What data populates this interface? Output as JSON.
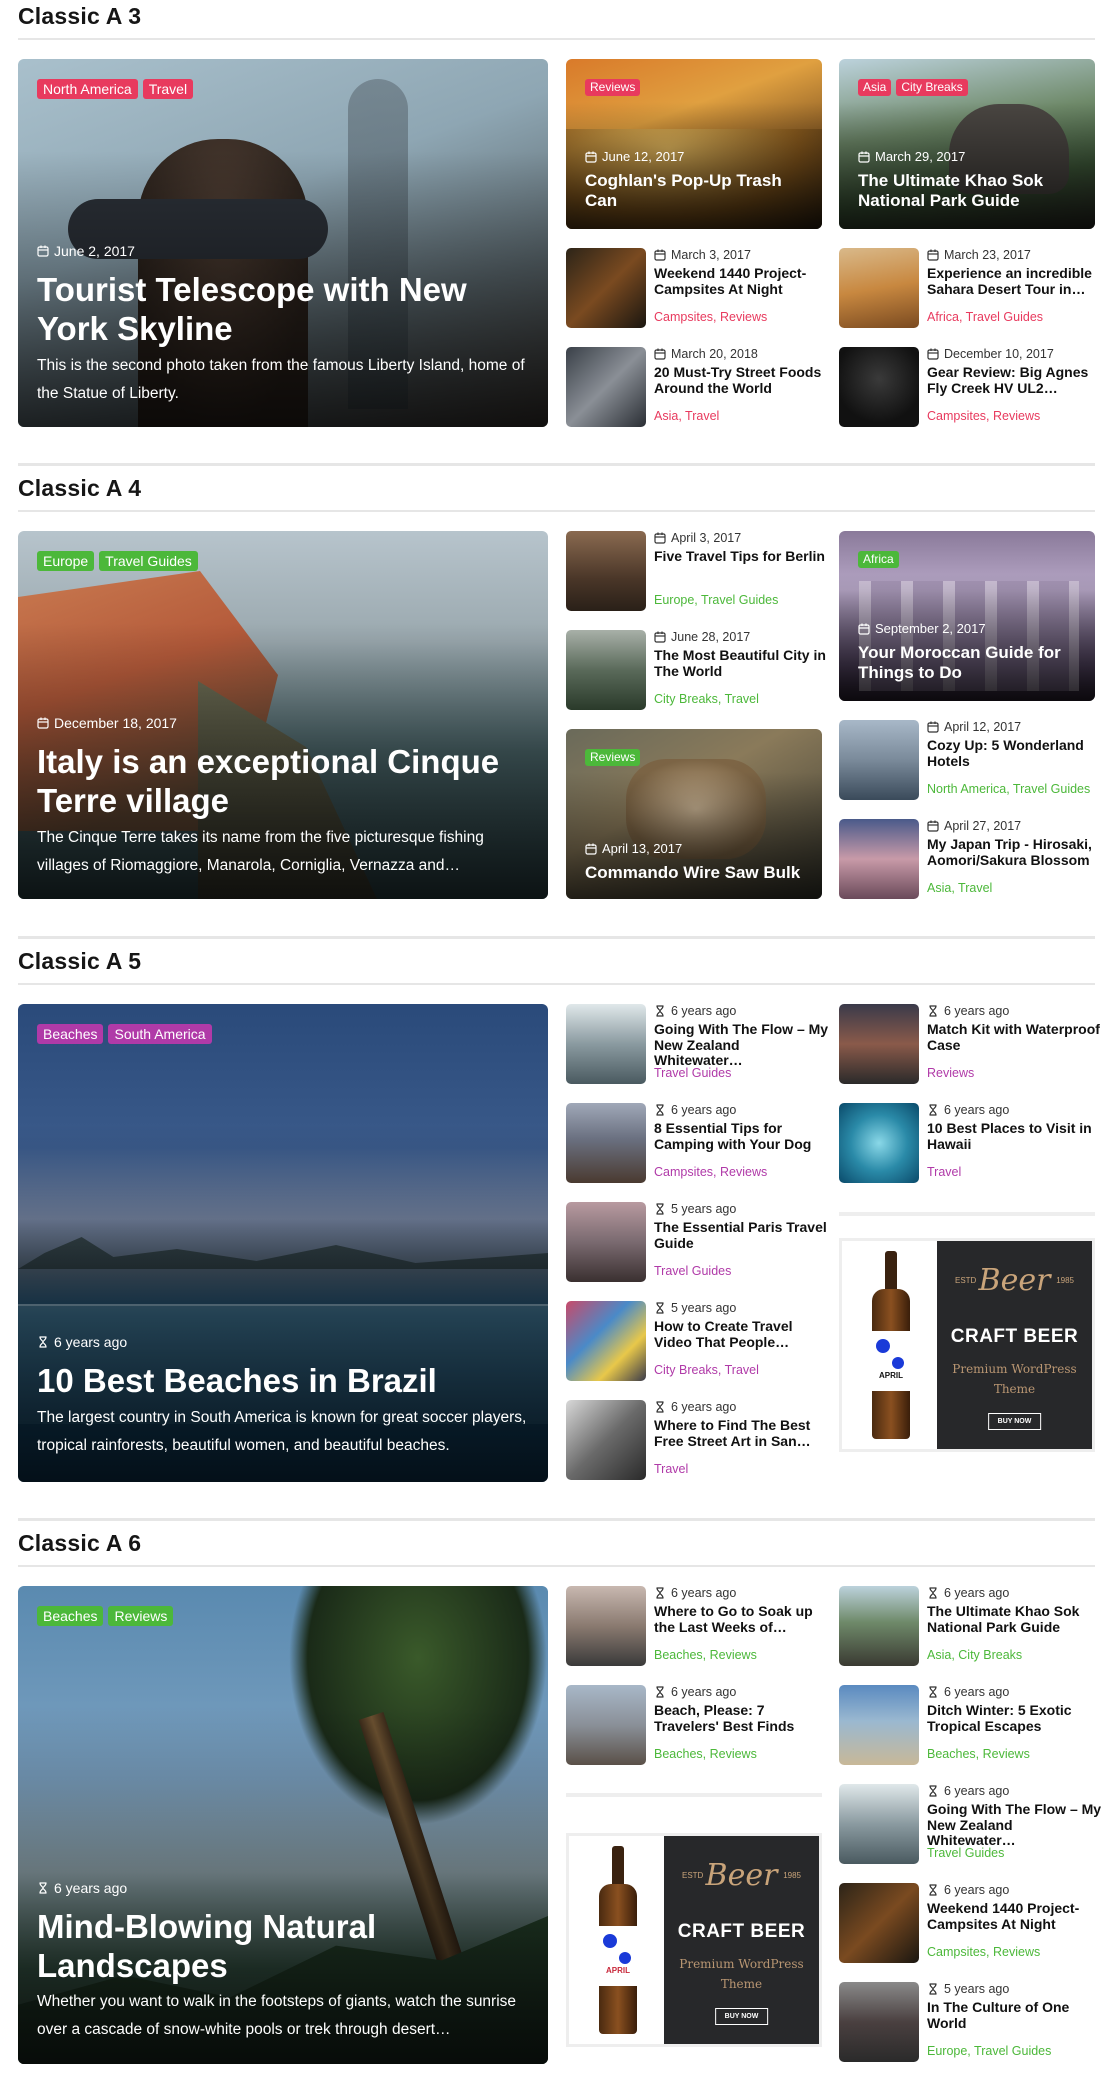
{
  "colors": {
    "red": "#e83a5e",
    "green": "#4cb83a",
    "purple": "#b03aa8"
  },
  "sections": [
    {
      "title": "Classic A 3",
      "featured": {
        "tags": [
          "North America",
          "Travel"
        ],
        "date": "June 2, 2017",
        "title": "Tourist Telescope with New York Skyline",
        "excerpt": "This is the second photo taken from the famous Liberty Island, home of the Statue of Liberty."
      },
      "mid_cards": [
        {
          "tags": [
            "Reviews"
          ],
          "date": "June 12, 2017",
          "title": "Coghlan's Pop-Up Trash Can"
        },
        {
          "tags": [
            "Asia",
            "City Breaks"
          ],
          "date": "March 29, 2017",
          "title": "The Ultimate Khao Sok National Park Guide"
        }
      ],
      "items": [
        {
          "date": "March 3, 2017",
          "title": "Weekend 1440 Project-Campsites At Night",
          "cats": "Campsites, Reviews"
        },
        {
          "date": "March 20, 2018",
          "title": "20 Must-Try Street Foods Around the World",
          "cats": "Asia, Travel"
        },
        {
          "date": "March 23, 2017",
          "title": "Experience an incredible Sahara Desert Tour in…",
          "cats": "Africa, Travel Guides"
        },
        {
          "date": "December 10, 2017",
          "title": "Gear Review: Big Agnes Fly Creek HV UL2…",
          "cats": "Campsites, Reviews"
        }
      ]
    },
    {
      "title": "Classic A 4",
      "featured": {
        "tags": [
          "Europe",
          "Travel Guides"
        ],
        "date": "December 18, 2017",
        "title": "Italy is an exceptional Cinque Terre village",
        "excerpt": "The Cinque Terre takes its name from the five picturesque fishing villages of Riomaggiore, Manarola, Corniglia, Vernazza and…"
      },
      "mid_cards": [
        {
          "tags": [
            "Reviews"
          ],
          "date": "April 13, 2017",
          "title": "Commando Wire Saw Bulk"
        },
        {
          "tags": [
            "Africa"
          ],
          "date": "September 2, 2017",
          "title": "Your Moroccan Guide for Things to Do"
        }
      ],
      "items": [
        {
          "date": "April 3, 2017",
          "title": "Five Travel Tips for Berlin",
          "cats": "Europe, Travel Guides"
        },
        {
          "date": "June 28, 2017",
          "title": "The Most Beautiful City in The World",
          "cats": "City Breaks, Travel"
        },
        {
          "date": "April 12, 2017",
          "title": "Cozy Up: 5 Wonderland Hotels",
          "cats": "North America, Travel Guides"
        },
        {
          "date": "April 27, 2017",
          "title": "My Japan Trip - Hirosaki, Aomori/Sakura Blossom",
          "cats": "Asia, Travel"
        }
      ]
    },
    {
      "title": "Classic A 5",
      "featured": {
        "tags": [
          "Beaches",
          "South America"
        ],
        "date": "6 years ago",
        "title": "10 Best Beaches in Brazil",
        "excerpt": "The largest country in South America is known for great soccer players, tropical rainforests, beautiful women, and beautiful beaches."
      },
      "items": [
        {
          "date": "6 years ago",
          "title": "Going With The Flow – My New Zealand Whitewater…",
          "cats": "Travel Guides"
        },
        {
          "date": "6 years ago",
          "title": "8 Essential Tips for Camping with Your Dog",
          "cats": "Campsites, Reviews"
        },
        {
          "date": "5 years ago",
          "title": "The Essential Paris Travel Guide",
          "cats": "Travel Guides"
        },
        {
          "date": "5 years ago",
          "title": "How to Create Travel Video That People…",
          "cats": "City Breaks, Travel"
        },
        {
          "date": "6 years ago",
          "title": "Where to Find The Best Free Street Art in San…",
          "cats": "Travel"
        },
        {
          "date": "6 years ago",
          "title": "Match Kit with Waterproof Case",
          "cats": "Reviews"
        },
        {
          "date": "6 years ago",
          "title": "10 Best Places to Visit in Hawaii",
          "cats": "Travel"
        }
      ]
    },
    {
      "title": "Classic A 6",
      "featured": {
        "tags": [
          "Beaches",
          "Reviews"
        ],
        "date": "6 years ago",
        "title": "Mind-Blowing Natural Landscapes",
        "excerpt": "Whether you want to walk in the footsteps of giants, watch the sunrise over a cascade of snow-white pools or trek through desert…"
      },
      "items": [
        {
          "date": "6 years ago",
          "title": "Where to Go to Soak up the Last Weeks of…",
          "cats": "Beaches, Reviews"
        },
        {
          "date": "6 years ago",
          "title": "Beach, Please: 7 Travelers' Best Finds",
          "cats": "Beaches, Reviews"
        },
        {
          "date": "6 years ago",
          "title": "The Ultimate Khao Sok National Park Guide",
          "cats": "Asia, City Breaks"
        },
        {
          "date": "6 years ago",
          "title": "Ditch Winter: 5 Exotic Tropical Escapes",
          "cats": "Beaches, Reviews"
        },
        {
          "date": "6 years ago",
          "title": "Going With The Flow – My New Zealand Whitewater…",
          "cats": "Travel Guides"
        },
        {
          "date": "6 years ago",
          "title": "Weekend 1440 Project-Campsites At Night",
          "cats": "Campsites, Reviews"
        },
        {
          "date": "5 years ago",
          "title": "In The Culture of One World",
          "cats": "Europe, Travel Guides"
        }
      ]
    }
  ],
  "ad": {
    "script": "Beer",
    "estd": "ESTD",
    "year": "1985",
    "headline": "CRAFT BEER",
    "line1": "Premium WordPress",
    "line2": "Theme",
    "button": "BUY NOW",
    "label": "APRIL"
  }
}
